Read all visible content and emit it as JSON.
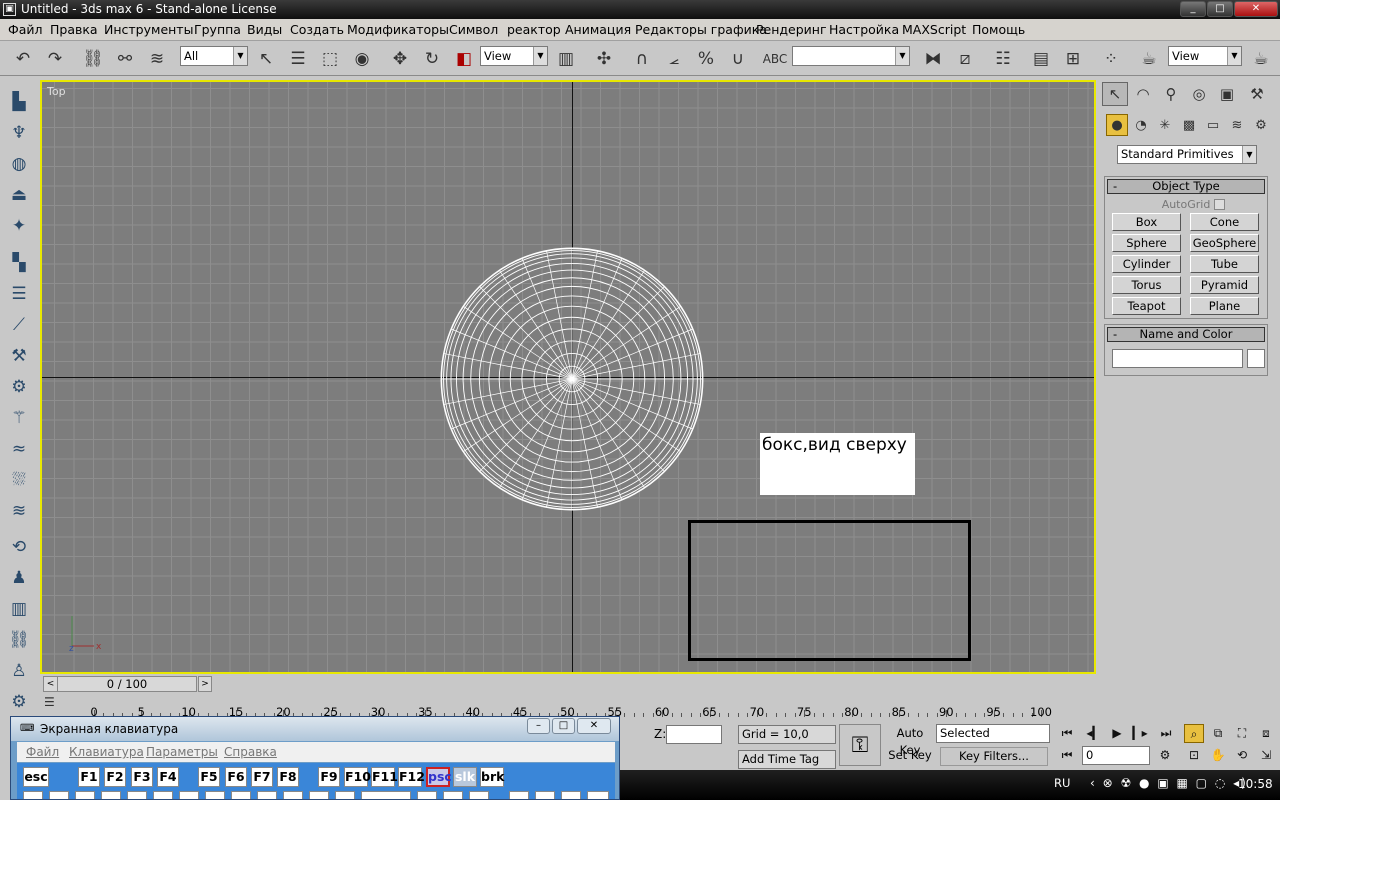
{
  "window": {
    "title": "Untitled - 3ds max 6 - Stand-alone License",
    "min": "_",
    "max": "□",
    "close": "✕"
  },
  "menu": [
    "Файл",
    "Правка",
    "Инструменты",
    "Группа",
    "Виды",
    "Создать",
    "Модификаторы",
    "Символ",
    "реактор",
    "Анимация",
    "Редакторы графика",
    "Рендеринг",
    "Настройка",
    "MAXScript",
    "Помощь"
  ],
  "toolbar": {
    "selection_filter": "All",
    "ref_coord": "View",
    "named_selection": "",
    "render_view": "View"
  },
  "viewport": {
    "label": "Top",
    "annotation": "бокс,вид сверху",
    "gizmo_x": "x",
    "gizmo_z": "z"
  },
  "command_panel": {
    "category": "Standard Primitives",
    "object_type_title": "Object Type",
    "autogrid_label": "AutoGrid",
    "buttons": [
      "Box",
      "Cone",
      "Sphere",
      "GeoSphere",
      "Cylinder",
      "Tube",
      "Torus",
      "Pyramid",
      "Teapot",
      "Plane"
    ],
    "name_color_title": "Name and Color",
    "collapse_symbol": "-",
    "name_value": ""
  },
  "time": {
    "slider_value": "0 / 100",
    "ruler_labels": [
      "0",
      "5",
      "10",
      "15",
      "20",
      "25",
      "30",
      "35",
      "40",
      "45",
      "50",
      "55",
      "60",
      "65",
      "70",
      "75",
      "80",
      "85",
      "90",
      "95",
      "100"
    ]
  },
  "status": {
    "z_label": "Z:",
    "grid": "Grid = 10,0",
    "add_time_tag": "Add Time Tag",
    "auto_key": "Auto Key",
    "set_key": "Set Key",
    "selected": "Selected",
    "key_filters": "Key Filters...",
    "frame": "0"
  },
  "taskbar": {
    "lang": "RU",
    "time": "10:58"
  },
  "osk": {
    "title": "Экранная клавиатура",
    "menu": [
      "Файл",
      "Клавиатура",
      "Параметры",
      "Справка"
    ],
    "keys": [
      "esc",
      "F1",
      "F2",
      "F3",
      "F4",
      "F5",
      "F6",
      "F7",
      "F8",
      "F9",
      "F10",
      "F11",
      "F12",
      "psc",
      "slk",
      "brk"
    ]
  }
}
